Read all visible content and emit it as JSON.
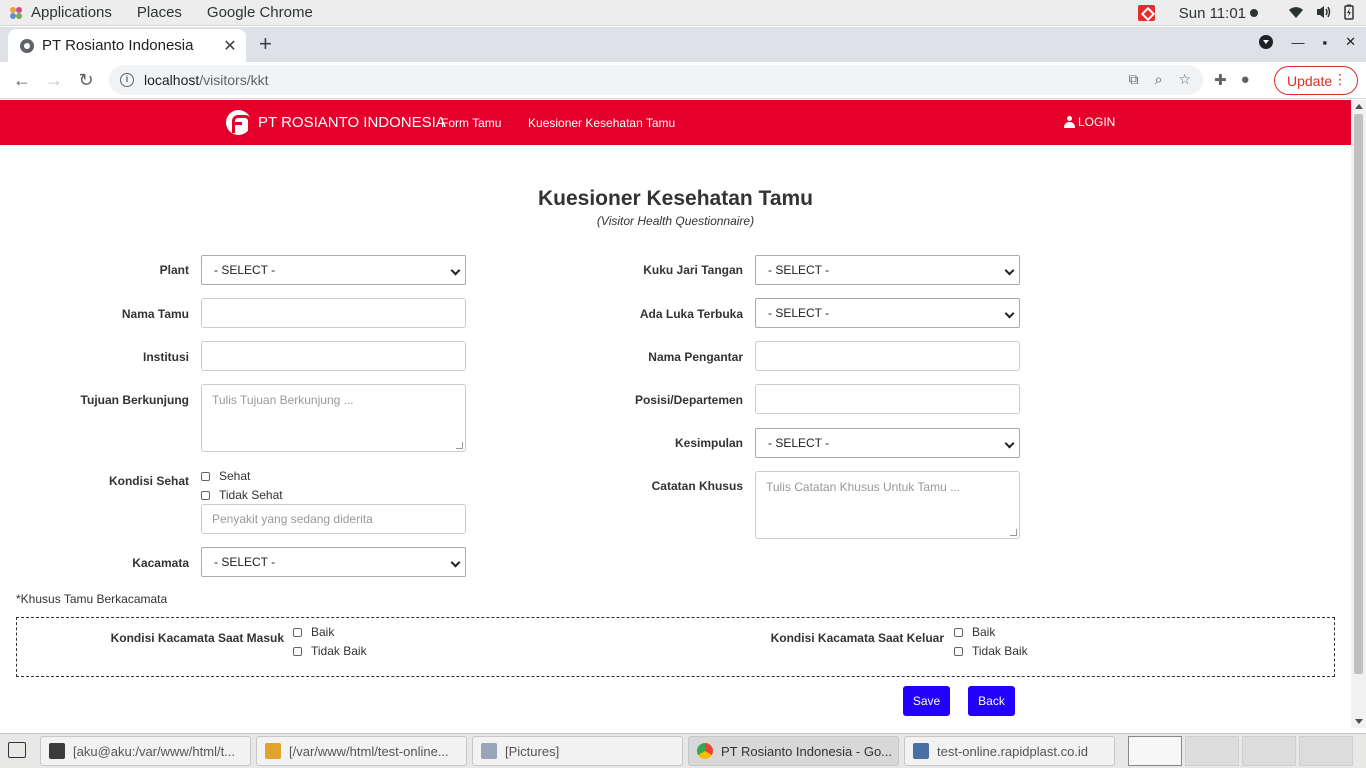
{
  "system_bar": {
    "applications": "Applications",
    "places": "Places",
    "app_name": "Google Chrome",
    "clock": "Sun 11:01"
  },
  "browser": {
    "tab_title": "PT Rosianto Indonesia",
    "url_host": "localhost",
    "url_path": "/visitors/kkt",
    "update_label": "Update"
  },
  "navbar": {
    "brand": "PT ROSIANTO INDONESIA",
    "links": [
      "Form Tamu",
      "Kuesioner Kesehatan Tamu"
    ],
    "login": "LOGIN",
    "color": "#e4002b"
  },
  "page": {
    "title": "Kuesioner Kesehatan Tamu",
    "subtitle": "(Visitor Health Questionnaire)"
  },
  "form_left": {
    "plant_label": "Plant",
    "plant_value": "- SELECT -",
    "nama_tamu_label": "Nama Tamu",
    "nama_tamu_value": "",
    "institusi_label": "Institusi",
    "institusi_value": "",
    "tujuan_label": "Tujuan Berkunjung",
    "tujuan_placeholder": "Tulis Tujuan Berkunjung ...",
    "kondisi_label": "Kondisi Sehat",
    "kondisi_options": [
      "Sehat",
      "Tidak Sehat"
    ],
    "penyakit_placeholder": "Penyakit yang sedang diderita",
    "kacamata_label": "Kacamata",
    "kacamata_value": "- SELECT -"
  },
  "form_right": {
    "kuku_label": "Kuku Jari Tangan",
    "kuku_value": "- SELECT -",
    "luka_label": "Ada Luka Terbuka",
    "luka_value": "- SELECT -",
    "pengantar_label": "Nama Pengantar",
    "pengantar_value": "",
    "posisi_label": "Posisi/Departemen",
    "posisi_value": "",
    "kesimpulan_label": "Kesimpulan",
    "kesimpulan_value": "- SELECT -",
    "catatan_label": "Catatan Khusus",
    "catatan_placeholder": "Tulis Catatan Khusus Untuk Tamu ..."
  },
  "glasses": {
    "note": "*Khusus Tamu Berkacamata",
    "masuk_label": "Kondisi Kacamata Saat Masuk",
    "keluar_label": "Kondisi Kacamata Saat Keluar",
    "options": [
      "Baik",
      "Tidak Baik"
    ]
  },
  "buttons": {
    "save": "Save",
    "back": "Back",
    "color": "#2200ff"
  },
  "taskbar": {
    "items": [
      "[aku@aku:/var/www/html/t...",
      "[/var/www/html/test-online...",
      "[Pictures]",
      "PT Rosianto Indonesia - Go...",
      "test-online.rapidplast.co.id"
    ]
  }
}
